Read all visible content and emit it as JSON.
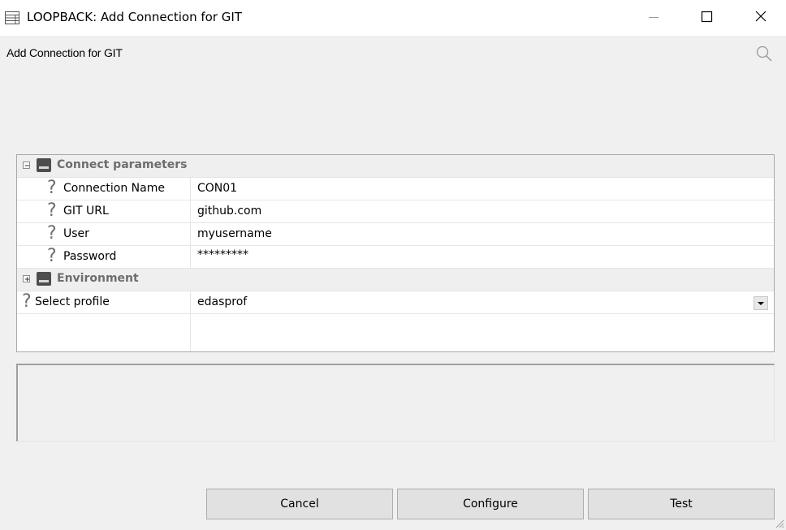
{
  "window": {
    "title": "LOOPBACK: Add Connection for GIT",
    "icons": {
      "app": "window-list-icon",
      "minimize": "minimize-icon",
      "maximize": "maximize-icon",
      "close": "close-icon"
    }
  },
  "header": {
    "label": "Add Connection for GIT",
    "search_icon": "search-icon"
  },
  "property_grid": {
    "categories": [
      {
        "label": "Connect parameters",
        "expanded": true,
        "properties": [
          {
            "name": "Connection Name",
            "value": "CON01"
          },
          {
            "name": "GIT URL",
            "value": "github.com"
          },
          {
            "name": "User",
            "value": "myusername"
          },
          {
            "name": "Password",
            "value": "*********"
          }
        ]
      },
      {
        "label": "Environment",
        "expanded": false,
        "properties": []
      }
    ],
    "select_profile": {
      "name": "Select profile",
      "value": "edasprof"
    },
    "help_glyph": "?"
  },
  "buttons": {
    "cancel": "Cancel",
    "configure": "Configure",
    "test": "Test"
  }
}
